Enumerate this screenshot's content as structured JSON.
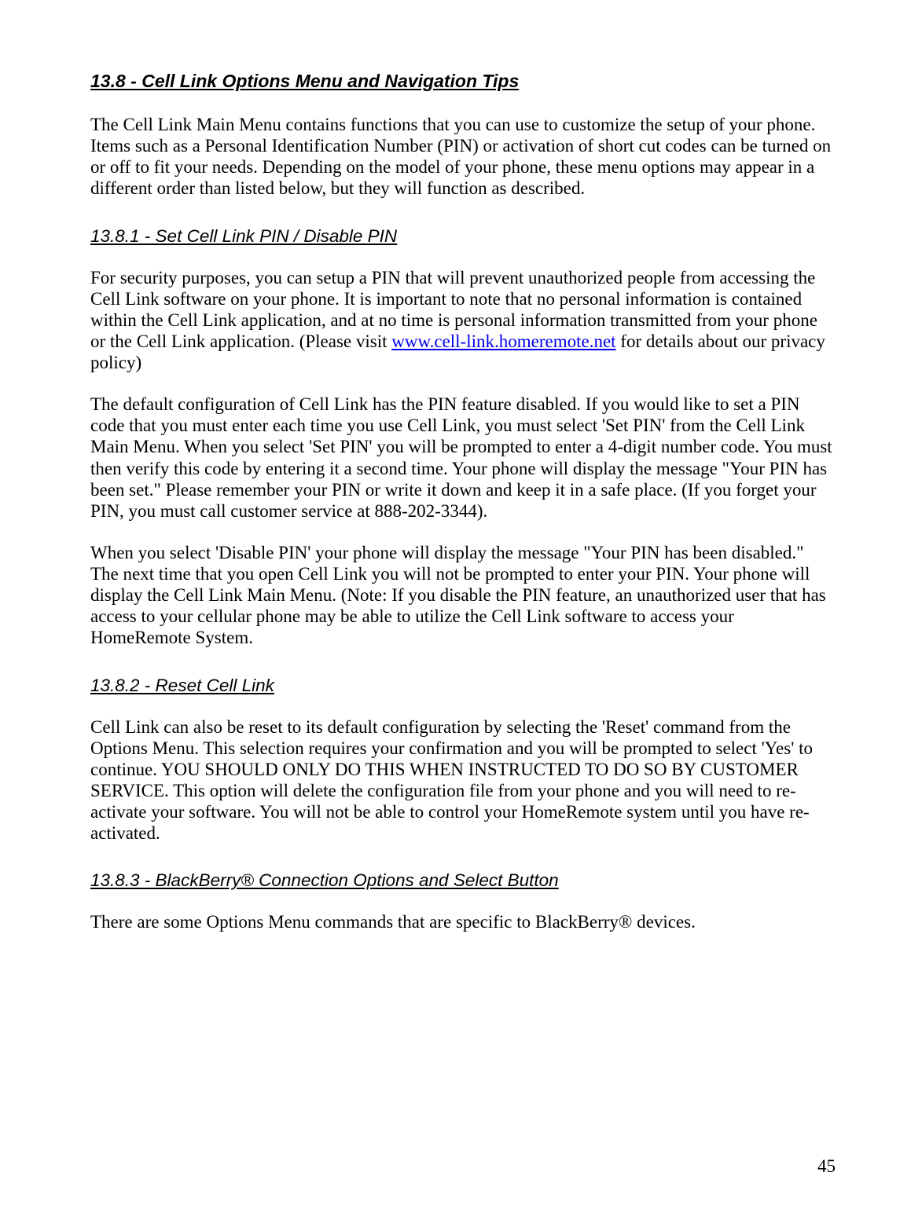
{
  "h138": "13.8 - Cell Link Options Menu and Navigation Tips",
  "p138_1": "The Cell Link Main Menu contains functions that you can use to customize the setup of your phone.  Items such as a Personal Identification Number (PIN) or activation of short cut codes can be turned on or off to fit your needs.  Depending on the model of your phone, these menu options may appear in a different order than listed below, but they will function as described.",
  "h1381": "13.8.1 - Set Cell Link PIN / Disable PIN",
  "p1381_1a": "For security purposes, you can setup a PIN that will prevent unauthorized people from accessing the Cell Link software on your phone.  It is important to note that no personal information is contained within the Cell Link application, and at no time is personal information transmitted from your phone or the Cell Link application.  (Please visit ",
  "p1381_1link": "www.cell-link.homeremote.net",
  "p1381_1b": " for details about our privacy policy)",
  "p1381_2": "The default configuration of Cell Link has the PIN feature disabled.  If you would like to set a PIN code that you must enter each time you use Cell Link, you must select 'Set PIN' from the Cell Link Main Menu.  When you select 'Set PIN' you will be prompted to enter a 4-digit number code.  You must then verify this code by entering it a second time.  Your phone will display the message \"Your PIN has been set.\"  Please remember your PIN or write it down and keep it in a safe place.  (If you forget your PIN, you must call customer service at 888-202-3344).",
  "p1381_3": "When you select 'Disable PIN' your phone will display the message \"Your PIN has been disabled.\"  The next time that you open Cell Link you will not be prompted to enter your PIN. Your phone will display the Cell Link Main Menu.  (Note: If you disable the PIN feature, an unauthorized user that has access to your cellular phone may be able to utilize the Cell Link software to access your HomeRemote System.",
  "h1382": "13.8.2 - Reset Cell Link",
  "p1382_1": "Cell Link can also be reset to its default configuration by selecting the 'Reset' command from the Options Menu.  This selection requires your confirmation and you will be prompted to select 'Yes' to continue. YOU SHOULD ONLY DO THIS WHEN INSTRUCTED TO DO SO BY CUSTOMER SERVICE. This option will delete the configuration file from your phone and you will need to re-activate your software. You will not be able to control your HomeRemote system until you have re-activated.",
  "h1383": "13.8.3 - BlackBerry® Connection Options and Select Button",
  "p1383_1": "There are some Options Menu commands that are specific to BlackBerry® devices.",
  "page_number": "45"
}
